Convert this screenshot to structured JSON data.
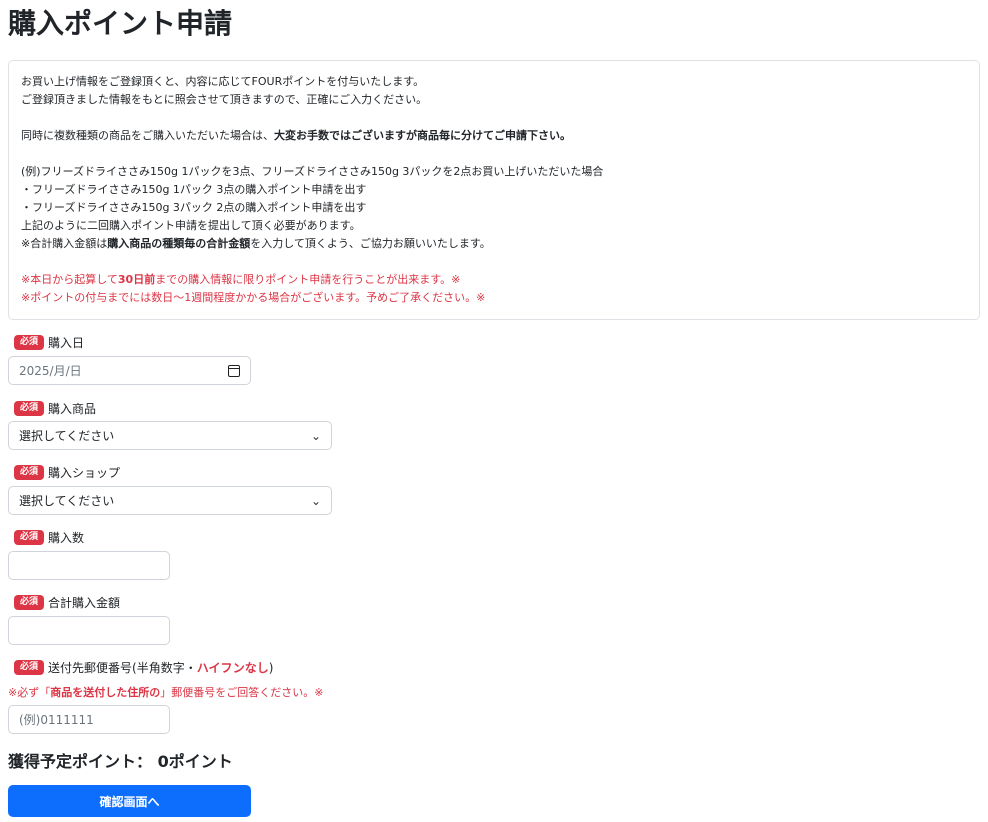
{
  "page": {
    "title": "購入ポイント申請"
  },
  "notice": {
    "line1": "お買い上げ情報をご登録頂くと、内容に応じてFOURポイントを付与いたします。",
    "line2": "ご登録頂きました情報をもとに照会させて頂きますので、正確にご入力ください。",
    "line3_prefix": "同時に複数種類の商品をご購入いただいた場合は、",
    "line3_bold": "大変お手数ではございますが商品毎に分けてご申請下さい。",
    "example1": "(例)フリーズドライささみ150g 1パックを3点、フリーズドライささみ150g 3パックを2点お買い上げいただいた場合",
    "example2": "・フリーズドライささみ150g 1パック 3点の購入ポイント申請を出す",
    "example3": "・フリーズドライささみ150g 3パック 2点の購入ポイント申請を出す",
    "example4": "上記のように二回購入ポイント申請を提出して頂く必要があります。",
    "total_prefix": "※合計購入金額は",
    "total_bold": "購入商品の種類毎の合計金額",
    "total_suffix": "を入力して頂くよう、ご協力お願いいたします。",
    "red1_prefix": "※本日から起算して",
    "red1_bold": "30日前",
    "red1_suffix": "までの購入情報に限りポイント申請を行うことが出来ます。※",
    "red2": "※ポイントの付与までには数日～1週間程度かかる場合がございます。予めご了承ください。※"
  },
  "form": {
    "required_badge": "必須",
    "purchase_date": {
      "label": "購入日",
      "value": "2025/月/日"
    },
    "product": {
      "label": "購入商品",
      "value": "選択してください"
    },
    "shop": {
      "label": "購入ショップ",
      "value": "選択してください"
    },
    "quantity": {
      "label": "購入数",
      "value": ""
    },
    "total_amount": {
      "label": "合計購入金額",
      "value": ""
    },
    "postal": {
      "label_prefix": "送付先郵便番号(半角数字・",
      "label_red": "ハイフンなし",
      "label_suffix": ")",
      "note_prefix": "※必ず「",
      "note_bold": "商品を送付した住所の",
      "note_suffix": "」郵便番号をご回答ください。※",
      "placeholder": "(例)0111111"
    }
  },
  "points": {
    "label": "獲得予定ポイント：",
    "value": "0ポイント"
  },
  "submit": {
    "label": "確認画面へ"
  }
}
